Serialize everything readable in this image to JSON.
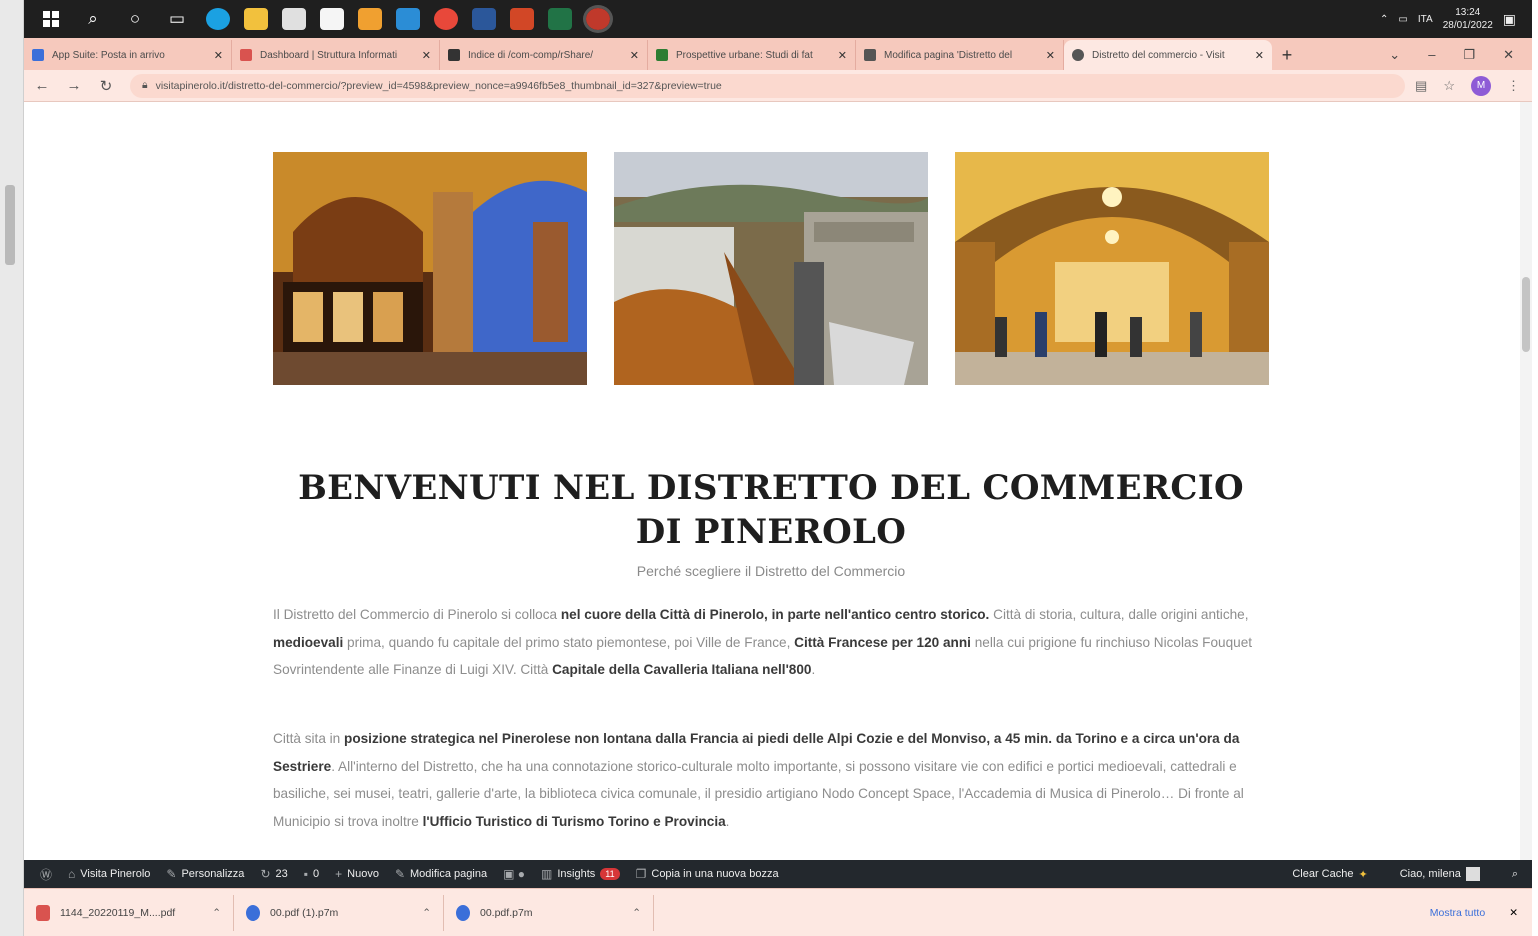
{
  "taskbar": {
    "language": "ITA",
    "time": "13:24",
    "date": "28/01/2022"
  },
  "tabs": [
    {
      "label": "App Suite: Posta in arrivo",
      "color": "#3b6fd9"
    },
    {
      "label": "Dashboard | Struttura Informati",
      "color": "#d9534f"
    },
    {
      "label": "Indice di /com-comp/rShare/",
      "color": "#333333"
    },
    {
      "label": "Prospettive urbane: Studi di fat",
      "color": "#2e7d32"
    },
    {
      "label": "Modifica pagina 'Distretto del",
      "color": "#555555"
    },
    {
      "label": "Distretto del commercio - Visit",
      "color": "#555555",
      "active": true
    }
  ],
  "address": {
    "url": "visitapinerolo.it/distretto-del-commercio/?preview_id=4598&preview_nonce=a9946fb5e8_thumbnail_id=327&preview=true",
    "profile_initial": "M"
  },
  "page": {
    "images": [
      {
        "alt": "portici-caffe"
      },
      {
        "alt": "vista-mercato"
      },
      {
        "alt": "portici-illuminati"
      }
    ],
    "title": "BENVENUTI NEL DISTRETTO DEL COMMERCIO DI PINEROLO",
    "subtitle": "Perché scegliere il Distretto del Commercio",
    "p1": {
      "a": "Il Distretto del Commercio di Pinerolo si colloca ",
      "b": "nel cuore della Città di Pinerolo, in parte nell'antico centro storico.",
      "c": " Città  di storia, cultura, dalle origini antiche, ",
      "d": "medioevali",
      "e": " prima, quando fu capitale del primo stato piemontese,  poi Ville de France, ",
      "f": "Città Francese per 120 anni",
      "g": " nella cui prigione fu rinchiuso Nicolas Fouquet Sovrintendente alle Finanze di Luigi XIV. Città ",
      "h": "Capitale della Cavalleria Italiana nell'800",
      "i": "."
    },
    "p2": {
      "a": "Città sita in ",
      "b": "posizione strategica nel Pinerolese non lontana dalla Francia ai piedi delle Alpi Cozie e del Monviso, a 45 min. da Torino e a circa un'ora da Sestriere",
      "c": ".  All'interno del Distretto, che ha una connotazione storico-culturale molto importante, si possono visitare vie con edifici e portici medioevali, cattedrali e basiliche, sei musei, teatri, gallerie d'arte, la biblioteca civica comunale, il presidio artigiano Nodo Concept Space, l'Accademia di Musica di Pinerolo… Di fronte al Municipio si trova inoltre ",
      "d": "l'Ufficio Turistico di Turismo Torino e Provincia",
      "e": "."
    }
  },
  "adminbar": {
    "site": "Visita Pinerolo",
    "customize": "Personalizza",
    "updates": "23",
    "comments": "0",
    "new": "Nuovo",
    "edit": "Modifica pagina",
    "insights": "Insights",
    "insights_badge": "11",
    "copy": "Copia in una nuova bozza",
    "clear_cache": "Clear Cache",
    "greeting": "Ciao, milena"
  },
  "downloads": [
    {
      "name": "1144_20220119_M....pdf",
      "color": "#d9534f"
    },
    {
      "name": "00.pdf (1).p7m",
      "color": "#3b6fd9"
    },
    {
      "name": "00.pdf.p7m",
      "color": "#3b6fd9"
    }
  ],
  "downloads_show_all": "Mostra tutto"
}
